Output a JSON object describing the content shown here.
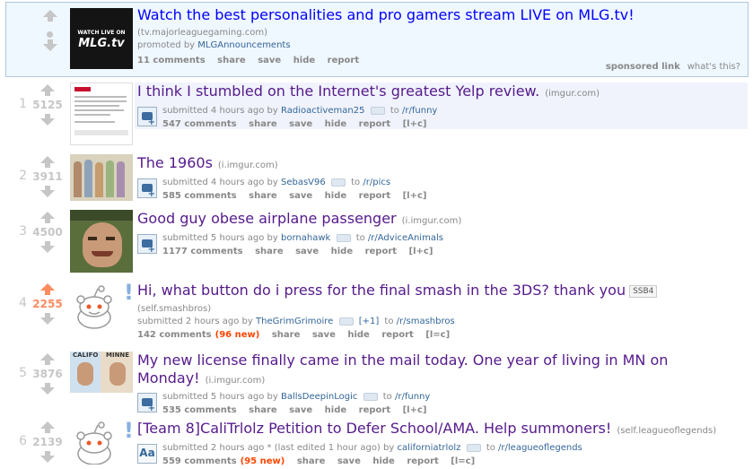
{
  "promoted": {
    "title": "Watch the best personalities and pro gamers stream LIVE on MLG.tv!",
    "domain": "(tv.majorleaguegaming.com)",
    "promoted_by_prefix": "promoted by",
    "promoted_by": "MLGAnnouncements",
    "thumb_text_top": "WATCH LIVE ON",
    "thumb_text_logo": "MLG.tv",
    "actions": [
      "11 comments",
      "share",
      "save",
      "hide",
      "report"
    ],
    "sponsored": "sponsored link",
    "whats_this": "what's this?"
  },
  "posts": [
    {
      "rank": "1",
      "score": "5125",
      "upvoted": false,
      "title": "I think I stumbled on the Internet's greatest Yelp review.",
      "domain": "(imgur.com)",
      "submitted": "submitted 4 hours ago by",
      "author": "Radioactiveman25",
      "to": "to",
      "subreddit": "/r/funny",
      "comments": "547 comments",
      "new": "",
      "actions": [
        "share",
        "save",
        "hide",
        "report",
        "[l+c]"
      ],
      "thumb_colors": [
        "#ffffff",
        "#e6e6e6",
        "#c8102e"
      ]
    },
    {
      "rank": "2",
      "score": "3911",
      "upvoted": false,
      "title": "The 1960s",
      "domain": "(i.imgur.com)",
      "submitted": "submitted 4 hours ago by",
      "author": "SebasV96",
      "to": "to",
      "subreddit": "/r/pics",
      "comments": "585 comments",
      "new": "",
      "actions": [
        "share",
        "save",
        "hide",
        "report",
        "[l+c]"
      ],
      "thumb_colors": [
        "#c7bfa8",
        "#8fa3b8",
        "#b8977a"
      ]
    },
    {
      "rank": "3",
      "score": "4500",
      "upvoted": false,
      "title": "Good guy obese airplane passenger",
      "domain": "(i.imgur.com)",
      "submitted": "submitted 5 hours ago by",
      "author": "bornahawk",
      "to": "to",
      "subreddit": "/r/AdviceAnimals",
      "comments": "1177 comments",
      "new": "",
      "actions": [
        "share",
        "save",
        "hide",
        "report",
        "[l+c]"
      ],
      "thumb_colors": [
        "#5a6e3c",
        "#c99a78",
        "#7a5a3a"
      ]
    },
    {
      "rank": "4",
      "score": "2255",
      "upvoted": true,
      "title": "Hi, what button do i press for the final smash in the 3DS? thank you",
      "flair": "SSB4",
      "domain": "(self.smashbros)",
      "submitted": "submitted 2 hours ago by",
      "author": "TheGrimGrimoire",
      "author_flair": "[+1]",
      "to": "to",
      "subreddit": "/r/smashbros",
      "comments": "142 comments",
      "new": "(96 new)",
      "actions": [
        "share",
        "save",
        "hide",
        "report",
        "[l=c]"
      ]
    },
    {
      "rank": "5",
      "score": "3876",
      "upvoted": false,
      "title": "My new license finally came in the mail today. One year of living in MN on Monday!",
      "domain": "(i.imgur.com)",
      "submitted": "submitted 5 hours ago by",
      "author": "BallsDeepinLogic",
      "to": "to",
      "subreddit": "/r/funny",
      "comments": "535 comments",
      "new": "",
      "actions": [
        "share",
        "save",
        "hide",
        "report",
        "[l+c]"
      ],
      "thumb_label": "CALIFO",
      "thumb_label2": "MINNE"
    },
    {
      "rank": "6",
      "score": "2139",
      "upvoted": false,
      "title": "[Team 8]CaliTrlolz Petition to Defer School/AMA. Help summoners!",
      "domain": "(self.leagueoflegends)",
      "submitted": "submitted 2 hours ago * (last edited 1 hour ago) by",
      "author": "californiatrlolz",
      "to": "to",
      "subreddit": "/r/leagueoflegends",
      "comments": "559 comments",
      "new": "(95 new)",
      "actions": [
        "share",
        "save",
        "hide",
        "report",
        "[l=c]"
      ],
      "expando_text": "Aa"
    }
  ]
}
